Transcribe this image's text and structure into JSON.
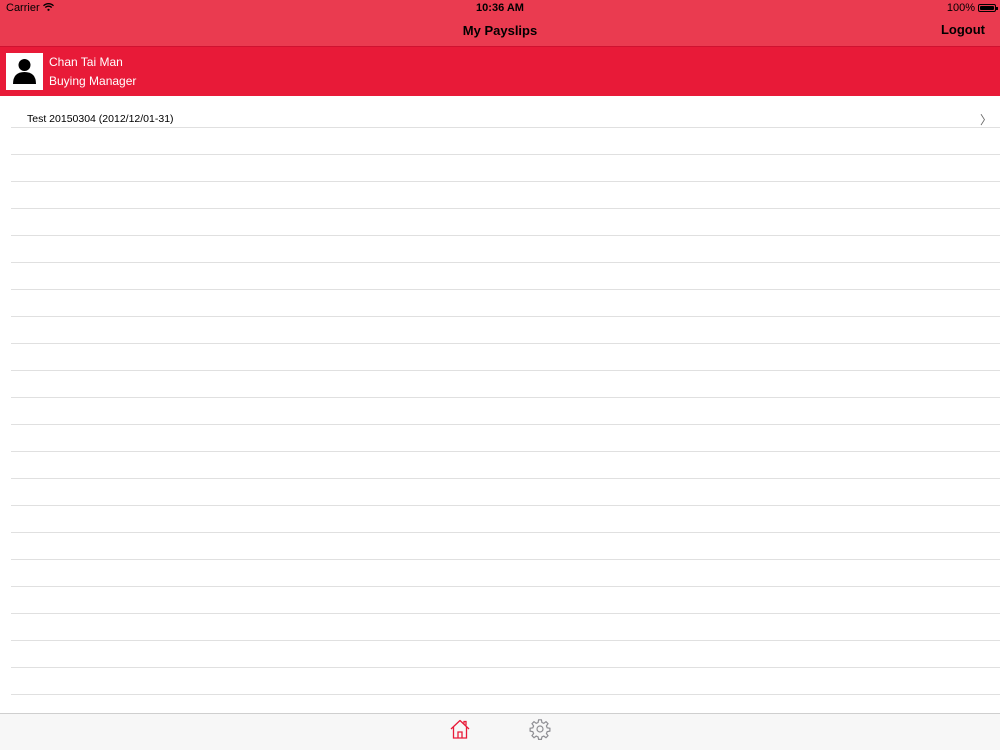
{
  "status_bar": {
    "carrier": "Carrier",
    "time": "10:36 AM",
    "battery": "100%"
  },
  "nav": {
    "title": "My Payslips",
    "logout_label": "Logout"
  },
  "profile": {
    "name": "Chan Tai Man",
    "role": "Buying Manager"
  },
  "payslips": [
    {
      "label": "Test 20150304 (2012/12/01-31)",
      "chevron": "〉"
    }
  ],
  "tabbar": {
    "tabs": [
      {
        "name": "home",
        "icon": "home-icon",
        "selected": true
      },
      {
        "name": "settings",
        "icon": "gear-icon",
        "selected": false
      }
    ]
  },
  "colors": {
    "nav_background": "#ea3b50",
    "profile_background": "#e81a38",
    "accent": "#e81a38",
    "tab_inactive": "#8e8e93"
  }
}
